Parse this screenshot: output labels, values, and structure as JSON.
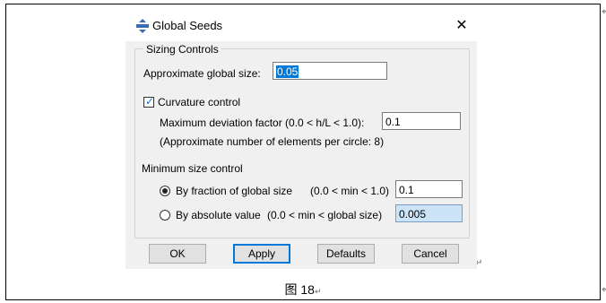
{
  "dialog": {
    "title": "Global Seeds",
    "close_glyph": "✕",
    "sizing_controls": {
      "legend": "Sizing Controls",
      "approx_global_size_label": "Approximate global size:",
      "approx_global_size_value": "0.05",
      "curvature_control_label": "Curvature control",
      "curvature_control_checked": true,
      "max_deviation_label": "Maximum deviation factor (0.0 < h/L < 1.0):",
      "max_deviation_value": "0.1",
      "approx_elements_note": "(Approximate number of elements per circle: 8)",
      "min_size_label": "Minimum size control",
      "by_fraction_label": "By fraction of global size",
      "by_fraction_range": "(0.0 < min < 1.0)",
      "by_fraction_value": "0.1",
      "by_fraction_selected": true,
      "by_absolute_label": "By absolute value",
      "by_absolute_range": "(0.0 < min < global size)",
      "by_absolute_value": "0.005"
    },
    "buttons": {
      "ok": "OK",
      "apply": "Apply",
      "defaults": "Defaults",
      "cancel": "Cancel"
    }
  },
  "document": {
    "caption": "图 18",
    "paragraph_mark": "↵",
    "cell_mark": "⌖"
  },
  "icons": {
    "title_icon": "seeds-icon",
    "check_color": "#1a6fd1",
    "selection_color": "#0078d7"
  }
}
